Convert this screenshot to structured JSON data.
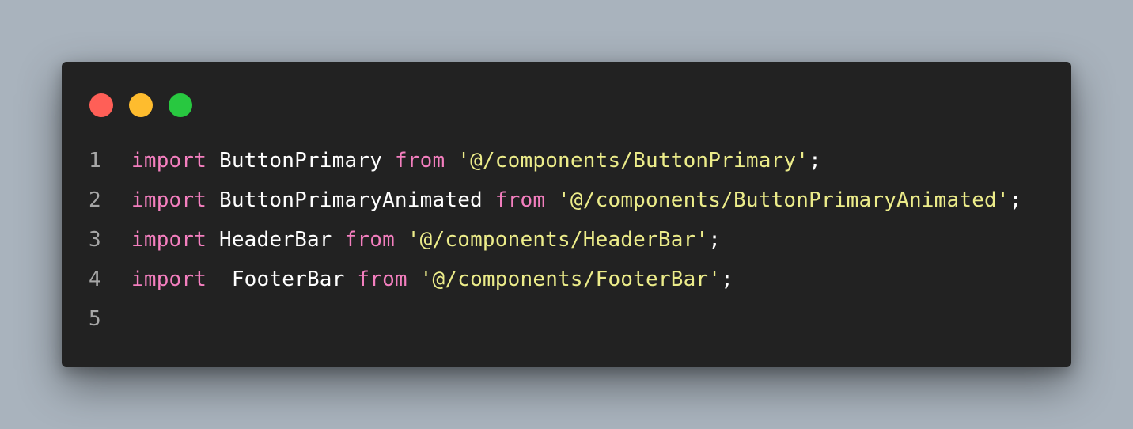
{
  "window": {
    "controls": [
      {
        "name": "close",
        "color": "#ff5f57"
      },
      {
        "name": "minimize",
        "color": "#febc2e"
      },
      {
        "name": "maximize",
        "color": "#28c840"
      }
    ]
  },
  "colors": {
    "keyword": "#f47fbf",
    "identifier": "#ffffff",
    "string": "#ecec8a",
    "punctuation": "#ffffff",
    "line_number": "#a7a7a7"
  },
  "code": {
    "lines": [
      {
        "number": "1",
        "tokens": [
          {
            "type": "keyword",
            "text": "import"
          },
          {
            "type": "identifier",
            "text": " ButtonPrimary "
          },
          {
            "type": "keyword",
            "text": "from"
          },
          {
            "type": "identifier",
            "text": " "
          },
          {
            "type": "string",
            "text": "'@/components/ButtonPrimary'"
          },
          {
            "type": "punctuation",
            "text": ";"
          }
        ]
      },
      {
        "number": "2",
        "tokens": [
          {
            "type": "keyword",
            "text": "import"
          },
          {
            "type": "identifier",
            "text": " ButtonPrimaryAnimated "
          },
          {
            "type": "keyword",
            "text": "from"
          },
          {
            "type": "identifier",
            "text": " "
          },
          {
            "type": "string",
            "text": "'@/components/ButtonPrimaryAnimated'"
          },
          {
            "type": "punctuation",
            "text": ";"
          }
        ]
      },
      {
        "number": "3",
        "tokens": [
          {
            "type": "keyword",
            "text": "import"
          },
          {
            "type": "identifier",
            "text": " HeaderBar "
          },
          {
            "type": "keyword",
            "text": "from"
          },
          {
            "type": "identifier",
            "text": " "
          },
          {
            "type": "string",
            "text": "'@/components/HeaderBar'"
          },
          {
            "type": "punctuation",
            "text": ";"
          }
        ]
      },
      {
        "number": "4",
        "tokens": [
          {
            "type": "keyword",
            "text": "import"
          },
          {
            "type": "identifier",
            "text": "  FooterBar "
          },
          {
            "type": "keyword",
            "text": "from"
          },
          {
            "type": "identifier",
            "text": " "
          },
          {
            "type": "string",
            "text": "'@/components/FooterBar'"
          },
          {
            "type": "punctuation",
            "text": ";"
          }
        ]
      },
      {
        "number": "5",
        "tokens": []
      }
    ]
  }
}
